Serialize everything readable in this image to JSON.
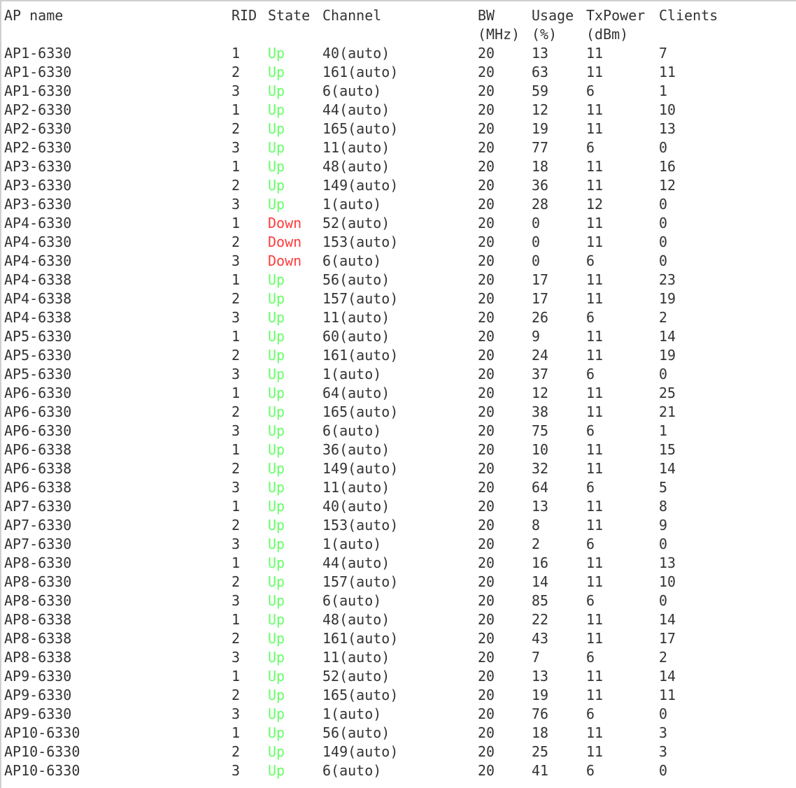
{
  "header": {
    "ap_name": "AP name",
    "rid": "RID",
    "state": "State",
    "channel": "Channel",
    "bw": "BW",
    "bw_unit": "(MHz)",
    "usage": "Usage",
    "usage_unit": "(%)",
    "txpower": "TxPower",
    "txpower_unit": "(dBm)",
    "clients": "Clients"
  },
  "colors": {
    "up": "#66ff66",
    "down": "#ff3b3b",
    "text": "#333333"
  },
  "rows": [
    {
      "ap": "AP1-6330",
      "rid": "1",
      "state": "Up",
      "channel": "40(auto)",
      "bw": "20",
      "usage": "13",
      "tx": "11",
      "clients": "7"
    },
    {
      "ap": "AP1-6330",
      "rid": "2",
      "state": "Up",
      "channel": "161(auto)",
      "bw": "20",
      "usage": "63",
      "tx": "11",
      "clients": "11"
    },
    {
      "ap": "AP1-6330",
      "rid": "3",
      "state": "Up",
      "channel": "6(auto)",
      "bw": "20",
      "usage": "59",
      "tx": "6",
      "clients": "1"
    },
    {
      "ap": "AP2-6330",
      "rid": "1",
      "state": "Up",
      "channel": "44(auto)",
      "bw": "20",
      "usage": "12",
      "tx": "11",
      "clients": "10"
    },
    {
      "ap": "AP2-6330",
      "rid": "2",
      "state": "Up",
      "channel": "165(auto)",
      "bw": "20",
      "usage": "19",
      "tx": "11",
      "clients": "13"
    },
    {
      "ap": "AP2-6330",
      "rid": "3",
      "state": "Up",
      "channel": "11(auto)",
      "bw": "20",
      "usage": "77",
      "tx": "6",
      "clients": "0"
    },
    {
      "ap": "AP3-6330",
      "rid": "1",
      "state": "Up",
      "channel": "48(auto)",
      "bw": "20",
      "usage": "18",
      "tx": "11",
      "clients": "16"
    },
    {
      "ap": "AP3-6330",
      "rid": "2",
      "state": "Up",
      "channel": "149(auto)",
      "bw": "20",
      "usage": "36",
      "tx": "11",
      "clients": "12"
    },
    {
      "ap": "AP3-6330",
      "rid": "3",
      "state": "Up",
      "channel": "1(auto)",
      "bw": "20",
      "usage": "28",
      "tx": "12",
      "clients": "0"
    },
    {
      "ap": "AP4-6330",
      "rid": "1",
      "state": "Down",
      "channel": "52(auto)",
      "bw": "20",
      "usage": "0",
      "tx": "11",
      "clients": "0"
    },
    {
      "ap": "AP4-6330",
      "rid": "2",
      "state": "Down",
      "channel": "153(auto)",
      "bw": "20",
      "usage": "0",
      "tx": "11",
      "clients": "0"
    },
    {
      "ap": "AP4-6330",
      "rid": "3",
      "state": "Down",
      "channel": "6(auto)",
      "bw": "20",
      "usage": "0",
      "tx": "6",
      "clients": "0"
    },
    {
      "ap": "AP4-6338",
      "rid": "1",
      "state": "Up",
      "channel": "56(auto)",
      "bw": "20",
      "usage": "17",
      "tx": "11",
      "clients": "23"
    },
    {
      "ap": "AP4-6338",
      "rid": "2",
      "state": "Up",
      "channel": "157(auto)",
      "bw": "20",
      "usage": "17",
      "tx": "11",
      "clients": "19"
    },
    {
      "ap": "AP4-6338",
      "rid": "3",
      "state": "Up",
      "channel": "11(auto)",
      "bw": "20",
      "usage": "26",
      "tx": "6",
      "clients": "2"
    },
    {
      "ap": "AP5-6330",
      "rid": "1",
      "state": "Up",
      "channel": "60(auto)",
      "bw": "20",
      "usage": "9",
      "tx": "11",
      "clients": "14"
    },
    {
      "ap": "AP5-6330",
      "rid": "2",
      "state": "Up",
      "channel": "161(auto)",
      "bw": "20",
      "usage": "24",
      "tx": "11",
      "clients": "19"
    },
    {
      "ap": "AP5-6330",
      "rid": "3",
      "state": "Up",
      "channel": "1(auto)",
      "bw": "20",
      "usage": "37",
      "tx": "6",
      "clients": "0"
    },
    {
      "ap": "AP6-6330",
      "rid": "1",
      "state": "Up",
      "channel": "64(auto)",
      "bw": "20",
      "usage": "12",
      "tx": "11",
      "clients": "25"
    },
    {
      "ap": "AP6-6330",
      "rid": "2",
      "state": "Up",
      "channel": "165(auto)",
      "bw": "20",
      "usage": "38",
      "tx": "11",
      "clients": "21"
    },
    {
      "ap": "AP6-6330",
      "rid": "3",
      "state": "Up",
      "channel": "6(auto)",
      "bw": "20",
      "usage": "75",
      "tx": "6",
      "clients": "1"
    },
    {
      "ap": "AP6-6338",
      "rid": "1",
      "state": "Up",
      "channel": "36(auto)",
      "bw": "20",
      "usage": "10",
      "tx": "11",
      "clients": "15"
    },
    {
      "ap": "AP6-6338",
      "rid": "2",
      "state": "Up",
      "channel": "149(auto)",
      "bw": "20",
      "usage": "32",
      "tx": "11",
      "clients": "14"
    },
    {
      "ap": "AP6-6338",
      "rid": "3",
      "state": "Up",
      "channel": "11(auto)",
      "bw": "20",
      "usage": "64",
      "tx": "6",
      "clients": "5"
    },
    {
      "ap": "AP7-6330",
      "rid": "1",
      "state": "Up",
      "channel": "40(auto)",
      "bw": "20",
      "usage": "13",
      "tx": "11",
      "clients": "8"
    },
    {
      "ap": "AP7-6330",
      "rid": "2",
      "state": "Up",
      "channel": "153(auto)",
      "bw": "20",
      "usage": "8",
      "tx": "11",
      "clients": "9"
    },
    {
      "ap": "AP7-6330",
      "rid": "3",
      "state": "Up",
      "channel": "1(auto)",
      "bw": "20",
      "usage": "2",
      "tx": "6",
      "clients": "0"
    },
    {
      "ap": "AP8-6330",
      "rid": "1",
      "state": "Up",
      "channel": "44(auto)",
      "bw": "20",
      "usage": "16",
      "tx": "11",
      "clients": "13"
    },
    {
      "ap": "AP8-6330",
      "rid": "2",
      "state": "Up",
      "channel": "157(auto)",
      "bw": "20",
      "usage": "14",
      "tx": "11",
      "clients": "10"
    },
    {
      "ap": "AP8-6330",
      "rid": "3",
      "state": "Up",
      "channel": "6(auto)",
      "bw": "20",
      "usage": "85",
      "tx": "6",
      "clients": "0"
    },
    {
      "ap": "AP8-6338",
      "rid": "1",
      "state": "Up",
      "channel": "48(auto)",
      "bw": "20",
      "usage": "22",
      "tx": "11",
      "clients": "14"
    },
    {
      "ap": "AP8-6338",
      "rid": "2",
      "state": "Up",
      "channel": "161(auto)",
      "bw": "20",
      "usage": "43",
      "tx": "11",
      "clients": "17"
    },
    {
      "ap": "AP8-6338",
      "rid": "3",
      "state": "Up",
      "channel": "11(auto)",
      "bw": "20",
      "usage": "7",
      "tx": "6",
      "clients": "2"
    },
    {
      "ap": "AP9-6330",
      "rid": "1",
      "state": "Up",
      "channel": "52(auto)",
      "bw": "20",
      "usage": "13",
      "tx": "11",
      "clients": "14"
    },
    {
      "ap": "AP9-6330",
      "rid": "2",
      "state": "Up",
      "channel": "165(auto)",
      "bw": "20",
      "usage": "19",
      "tx": "11",
      "clients": "11"
    },
    {
      "ap": "AP9-6330",
      "rid": "3",
      "state": "Up",
      "channel": "1(auto)",
      "bw": "20",
      "usage": "76",
      "tx": "6",
      "clients": "0"
    },
    {
      "ap": "AP10-6330",
      "rid": "1",
      "state": "Up",
      "channel": "56(auto)",
      "bw": "20",
      "usage": "18",
      "tx": "11",
      "clients": "3"
    },
    {
      "ap": "AP10-6330",
      "rid": "2",
      "state": "Up",
      "channel": "149(auto)",
      "bw": "20",
      "usage": "25",
      "tx": "11",
      "clients": "3"
    },
    {
      "ap": "AP10-6330",
      "rid": "3",
      "state": "Up",
      "channel": "6(auto)",
      "bw": "20",
      "usage": "41",
      "tx": "6",
      "clients": "0"
    }
  ]
}
